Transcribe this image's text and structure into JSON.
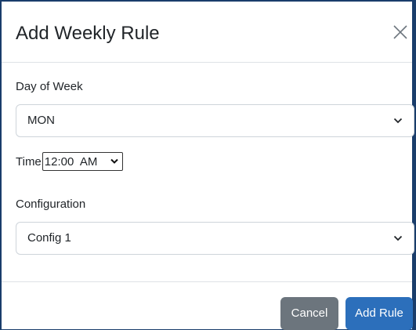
{
  "dialog": {
    "title": "Add Weekly Rule",
    "close_icon": "close-icon"
  },
  "day_of_week": {
    "label": "Day of Week",
    "value": "MON"
  },
  "time": {
    "label": "Time",
    "value": "12:00  AM"
  },
  "configuration": {
    "label": "Configuration",
    "value": "Config 1"
  },
  "footer": {
    "cancel_label": "Cancel",
    "add_label": "Add Rule"
  },
  "colors": {
    "primary": "#2c6fbb",
    "secondary": "#6c757d",
    "frame": "#1a3d6b"
  }
}
